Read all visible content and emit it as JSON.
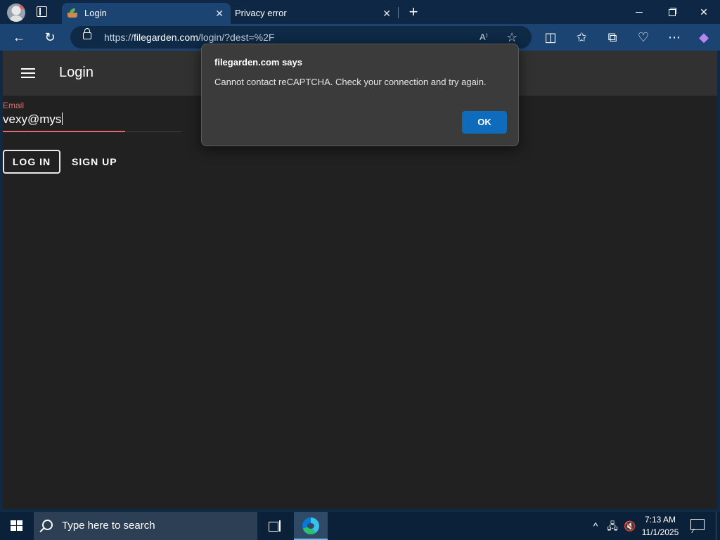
{
  "browser": {
    "tabs": [
      {
        "label": "Login",
        "active": true
      },
      {
        "label": "Privacy error",
        "active": false
      }
    ],
    "url_prefix": "https://",
    "url_domain": "filegarden.com",
    "url_path": "/login/?dest=%2F",
    "read_aloud": "A⁾"
  },
  "page": {
    "title": "Login",
    "email_label": "Email",
    "email_value": "vexy@mys",
    "login_button": "LOG IN",
    "signup_button": "SIGN UP"
  },
  "dialog": {
    "title": "filegarden.com says",
    "message": "Cannot contact reCAPTCHA. Check your connection and try again.",
    "ok_label": "OK"
  },
  "taskbar": {
    "search_placeholder": "Type here to search",
    "time": "7:13 AM",
    "date": "11/1/2025"
  },
  "colors": {
    "accent": "#0f6cbd",
    "error": "#e06b6b",
    "page_bg": "#212121",
    "appbar_bg": "#313131"
  }
}
